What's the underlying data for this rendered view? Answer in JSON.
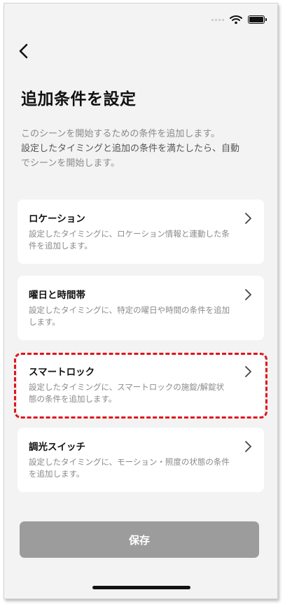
{
  "status_bar": {
    "icons": [
      "signal-dots-icon",
      "wifi-icon",
      "battery-icon"
    ]
  },
  "header": {
    "back_icon": "chevron-left-icon",
    "title": "追加条件を設定"
  },
  "description": {
    "line1": "このシーンを開始するための条件を追加します。",
    "line2": "設定したタイミングと追加の条件を満たしたら、自動",
    "line3": "でシーンを開始します。"
  },
  "conditions": [
    {
      "title": "ロケーション",
      "desc": "設定したタイミングに、ロケーション情報と連動した条件を追加します。"
    },
    {
      "title": "曜日と時間帯",
      "desc": "設定したタイミングに、特定の曜日や時間の条件を追加します。"
    },
    {
      "title": "スマートロック",
      "desc": "設定したタイミングに、スマートロックの施錠/解錠状態の条件を追加します。"
    },
    {
      "title": "調光スイッチ",
      "desc": "設定したタイミングに、モーション・照度の状態の条件を追加します。"
    }
  ],
  "save_label": "保存",
  "colors": {
    "highlight": "#e0151b",
    "save_button": "#9c9c9c",
    "background": "#f3f3f3"
  }
}
